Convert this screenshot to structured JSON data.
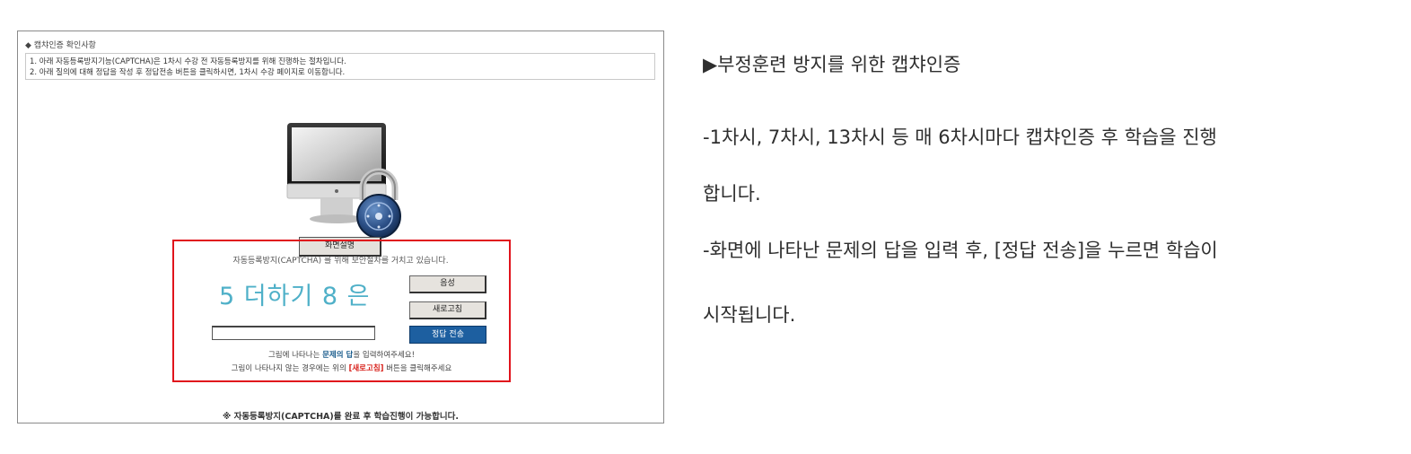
{
  "screenshot": {
    "section_title": "◆ 캡챠인증 확인사항",
    "notice_lines": [
      "1. 아래 자동등록방지기능(CAPTCHA)은 1차시 수강 전 자동등록방지를 위해 진행하는 절차입니다.",
      "2. 아래 질의에 대해 정답을 작성 후 정답전송 버튼을 클릭하시면, 1차시 수강 페이지로 이동합니다."
    ],
    "security_caption": "자동등록방지(CAPTCHA) 를 위해 보안절차를 거치고 있습니다.",
    "explain_button": "화면설명",
    "captcha": {
      "question": "5 더하기 8 은",
      "answer_value": "",
      "audio_button": "음성",
      "refresh_button": "새로고침",
      "submit_button": "정답 전송",
      "instruction1_pre": "그림에 나타나는 ",
      "instruction1_em": "문제의 답",
      "instruction1_post": "을 입력하여주세요!",
      "instruction2_pre": "그림이 나타나지 않는 경우에는 위의 ",
      "instruction2_em": "[새로고침]",
      "instruction2_post": " 버튼을 클릭해주세요"
    },
    "footer_note": "※ 자동등록방지(CAPTCHA)를 완료 후 학습진행이 가능합니다."
  },
  "description": {
    "heading": "▶부정훈련 방지를 위한 캡챠인증",
    "line1": "-1차시, 7차시, 13차시 등 매 6차시마다 캡챠인증 후 학습을 진행",
    "line2": "합니다.",
    "line3": "-화면에 나타난 문제의 답을 입력 후, [정답 전송]을 누르면 학습이",
    "line4": "시작됩니다."
  },
  "colors": {
    "captcha_border": "#e0141c",
    "captcha_text": "#4fb0c8",
    "submit_button": "#1d5fa0"
  },
  "icons": [
    "monitor-icon",
    "padlock-icon"
  ]
}
